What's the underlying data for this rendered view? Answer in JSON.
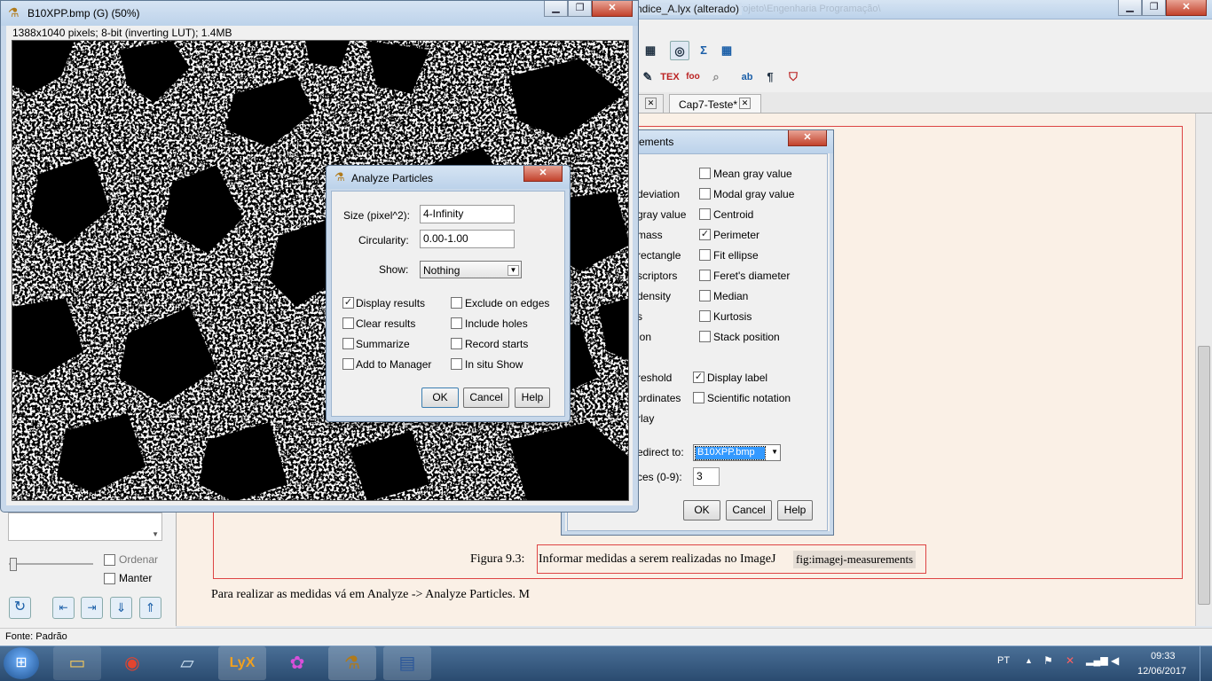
{
  "lyx": {
    "title": "ndice_A.lyx (alterado)",
    "title_dim": "DissertaçãoPTF - Manual\\Modelo\\Documento Projeto\\Engenharia Programação\\",
    "tabs": [
      {
        "label": "Cap7-Teste*"
      }
    ],
    "figure_caption_label": "Figura 9.3:",
    "figure_caption_text": "Informar medidas a serem realizadas no ImageJ",
    "figure_ref": "fig:imagej-measurements",
    "body_text": "Para realizar as medidas vá em Analyze -> Analyze Particles. M",
    "status": "Fonte: Padrão",
    "sidebar": {
      "ordenar": "Ordenar",
      "manter": "Manter"
    }
  },
  "image_window": {
    "title": "B10XPP.bmp (G) (50%)",
    "info": "1388x1040 pixels; 8-bit (inverting LUT); 1.4MB"
  },
  "measurements": {
    "title": "ements",
    "left_partial": [
      "deviation",
      "gray value",
      "mass",
      "rectangle",
      "scriptors",
      "density",
      "s",
      "ion"
    ],
    "right_options": [
      {
        "label": "Mean gray value",
        "checked": false
      },
      {
        "label": "Modal gray value",
        "checked": false
      },
      {
        "label": "Centroid",
        "checked": false
      },
      {
        "label": "Perimeter",
        "checked": true
      },
      {
        "label": "Fit ellipse",
        "checked": false
      },
      {
        "label": "Feret's diameter",
        "checked": false
      },
      {
        "label": "Median",
        "checked": false
      },
      {
        "label": "Kurtosis",
        "checked": false
      },
      {
        "label": "Stack position",
        "checked": false
      }
    ],
    "lower_left_partial": [
      "reshold",
      "ordinates",
      "rlay"
    ],
    "lower_right": [
      {
        "label": "Display label",
        "checked": true
      },
      {
        "label": "Scientific notation",
        "checked": false
      }
    ],
    "redirect_label": "edirect to:",
    "redirect_value": "B10XPP.bmp",
    "decimal_label": "ces (0-9):",
    "decimal_value": "3",
    "ok": "OK",
    "cancel": "Cancel",
    "help": "Help"
  },
  "analyze": {
    "title": "Analyze Particles",
    "size_label": "Size (pixel^2):",
    "size_value": "4-Infinity",
    "circ_label": "Circularity:",
    "circ_value": "0.00-1.00",
    "show_label": "Show:",
    "show_value": "Nothing",
    "options_left": [
      {
        "label": "Display results",
        "checked": true
      },
      {
        "label": "Clear results",
        "checked": false
      },
      {
        "label": "Summarize",
        "checked": false
      },
      {
        "label": "Add to Manager",
        "checked": false
      }
    ],
    "options_right": [
      {
        "label": "Exclude on edges",
        "checked": false
      },
      {
        "label": "Include holes",
        "checked": false
      },
      {
        "label": "Record starts",
        "checked": false
      },
      {
        "label": "In situ Show",
        "checked": false
      }
    ],
    "ok": "OK",
    "cancel": "Cancel",
    "help": "Help"
  },
  "taskbar": {
    "lang": "PT",
    "time": "09:33",
    "date": "12/06/2017"
  }
}
